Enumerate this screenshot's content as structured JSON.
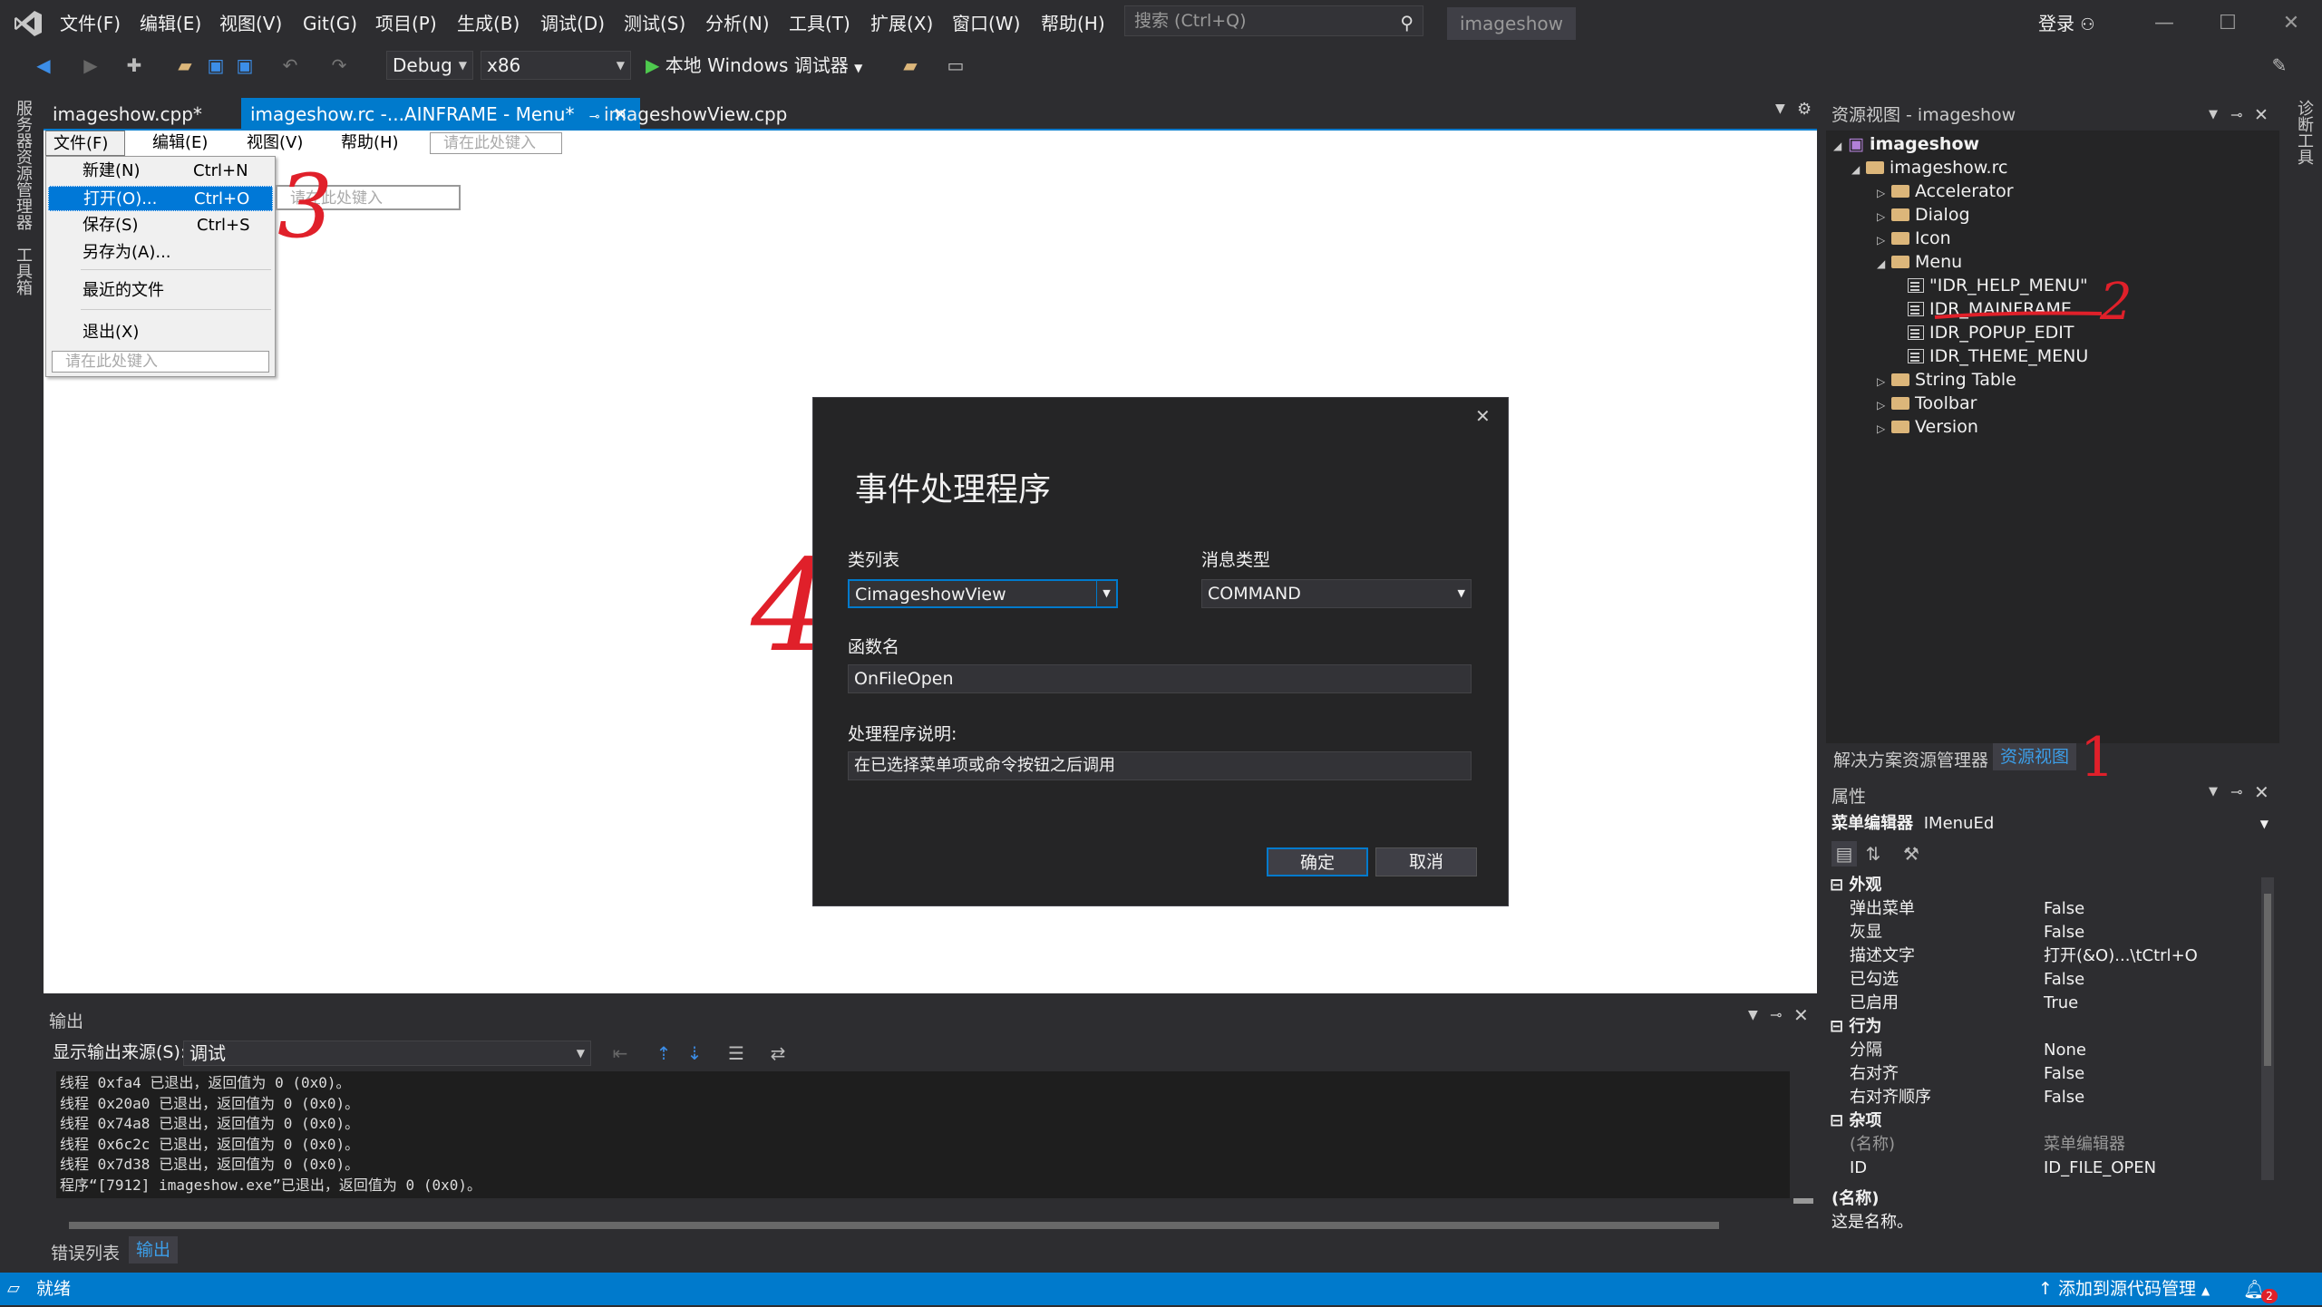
{
  "titlebar": {
    "menus": [
      "文件(F)",
      "编辑(E)",
      "视图(V)",
      "Git(G)",
      "项目(P)",
      "生成(B)",
      "调试(D)",
      "测试(S)",
      "分析(N)",
      "工具(T)",
      "扩展(X)",
      "窗口(W)",
      "帮助(H)"
    ],
    "search_placeholder": "搜索 (Ctrl+Q)",
    "solution_name": "imageshow",
    "login": "登录",
    "min": "—",
    "max": "☐",
    "close": "✕"
  },
  "toolbar": {
    "config": "Debug",
    "platform": "x86",
    "run_label": "本地 Windows 调试器"
  },
  "left_strip": {
    "server_explorer": "服务器资源管理器",
    "toolbox": "工具箱"
  },
  "right_strip": {
    "diagnostics": "诊断工具"
  },
  "doc_tabs": [
    {
      "label": "imageshow.cpp*"
    },
    {
      "label": "imageshow.rc -...AINFRAME - Menu*"
    },
    {
      "label": "imageshowView.cpp"
    }
  ],
  "menu_editor": {
    "menubar": [
      "文件(F)",
      "编辑(E)",
      "视图(V)",
      "帮助(H)"
    ],
    "type_here": "请在此处键入",
    "file_items": [
      {
        "label": "新建(N)",
        "shortcut": "Ctrl+N"
      },
      {
        "label": "打开(O)...",
        "shortcut": "Ctrl+O"
      },
      {
        "label": "保存(S)",
        "shortcut": "Ctrl+S"
      },
      {
        "label": "另存为(A)...",
        "shortcut": ""
      },
      {
        "label": "最近的文件",
        "shortcut": ""
      },
      {
        "label": "退出(X)",
        "shortcut": ""
      }
    ]
  },
  "annotations": {
    "one": "1",
    "two": "2",
    "three": "3",
    "four": "4"
  },
  "dialog": {
    "title": "事件处理程序",
    "class_list_label": "类列表",
    "class_list_value": "CimageshowView",
    "msg_type_label": "消息类型",
    "msg_type_value": "COMMAND",
    "func_name_label": "函数名",
    "func_name_value": "OnFileOpen",
    "desc_label": "处理程序说明:",
    "desc_value": "在已选择菜单项或命令按钮之后调用",
    "ok": "确定",
    "cancel": "取消",
    "close": "✕"
  },
  "output": {
    "title": "输出",
    "source_label": "显示输出来源(S):",
    "source_value": "调试",
    "lines": [
      "线程 0xfa4 已退出，返回值为 0 (0x0)。",
      "线程 0x20a0 已退出，返回值为 0 (0x0)。",
      "线程 0x74a8 已退出，返回值为 0 (0x0)。",
      "线程 0x6c2c 已退出，返回值为 0 (0x0)。",
      "线程 0x7d38 已退出，返回值为 0 (0x0)。",
      "程序“[7912] imageshow.exe”已退出，返回值为 0 (0x0)。"
    ],
    "tab_errors": "错误列表",
    "tab_output": "输出"
  },
  "resource_view": {
    "title": "资源视图 - imageshow",
    "root": "imageshow",
    "rc": "imageshow.rc",
    "folders": [
      "Accelerator",
      "Dialog",
      "Icon",
      "Menu"
    ],
    "menus": [
      "\"IDR_HELP_MENU\"",
      "IDR_MAINFRAME",
      "IDR_POPUP_EDIT",
      "IDR_THEME_MENU"
    ],
    "folders2": [
      "String Table",
      "Toolbar",
      "Version"
    ],
    "tab_solution": "解决方案资源管理器",
    "tab_resource": "资源视图"
  },
  "properties": {
    "title": "属性",
    "object": "菜单编辑器",
    "object_type": "IMenuEd",
    "cat_appearance": "外观",
    "appearance": [
      {
        "k": "弹出菜单",
        "v": "False"
      },
      {
        "k": "灰显",
        "v": "False"
      },
      {
        "k": "描述文字",
        "v": "打开(&O)...\\tCtrl+O"
      },
      {
        "k": "已勾选",
        "v": "False"
      },
      {
        "k": "已启用",
        "v": "True"
      }
    ],
    "cat_behavior": "行为",
    "behavior": [
      {
        "k": "分隔",
        "v": "None"
      },
      {
        "k": "右对齐",
        "v": "False"
      },
      {
        "k": "右对齐顺序",
        "v": "False"
      }
    ],
    "cat_misc": "杂项",
    "misc": [
      {
        "k": "(名称)",
        "v": "菜单编辑器"
      },
      {
        "k": "ID",
        "v": "ID_FILE_OPEN"
      }
    ],
    "desc_title": "(名称)",
    "desc_text": "这是名称。"
  },
  "status": {
    "ready": "就绪",
    "source_control": "添加到源代码管理",
    "notif_count": "2"
  }
}
